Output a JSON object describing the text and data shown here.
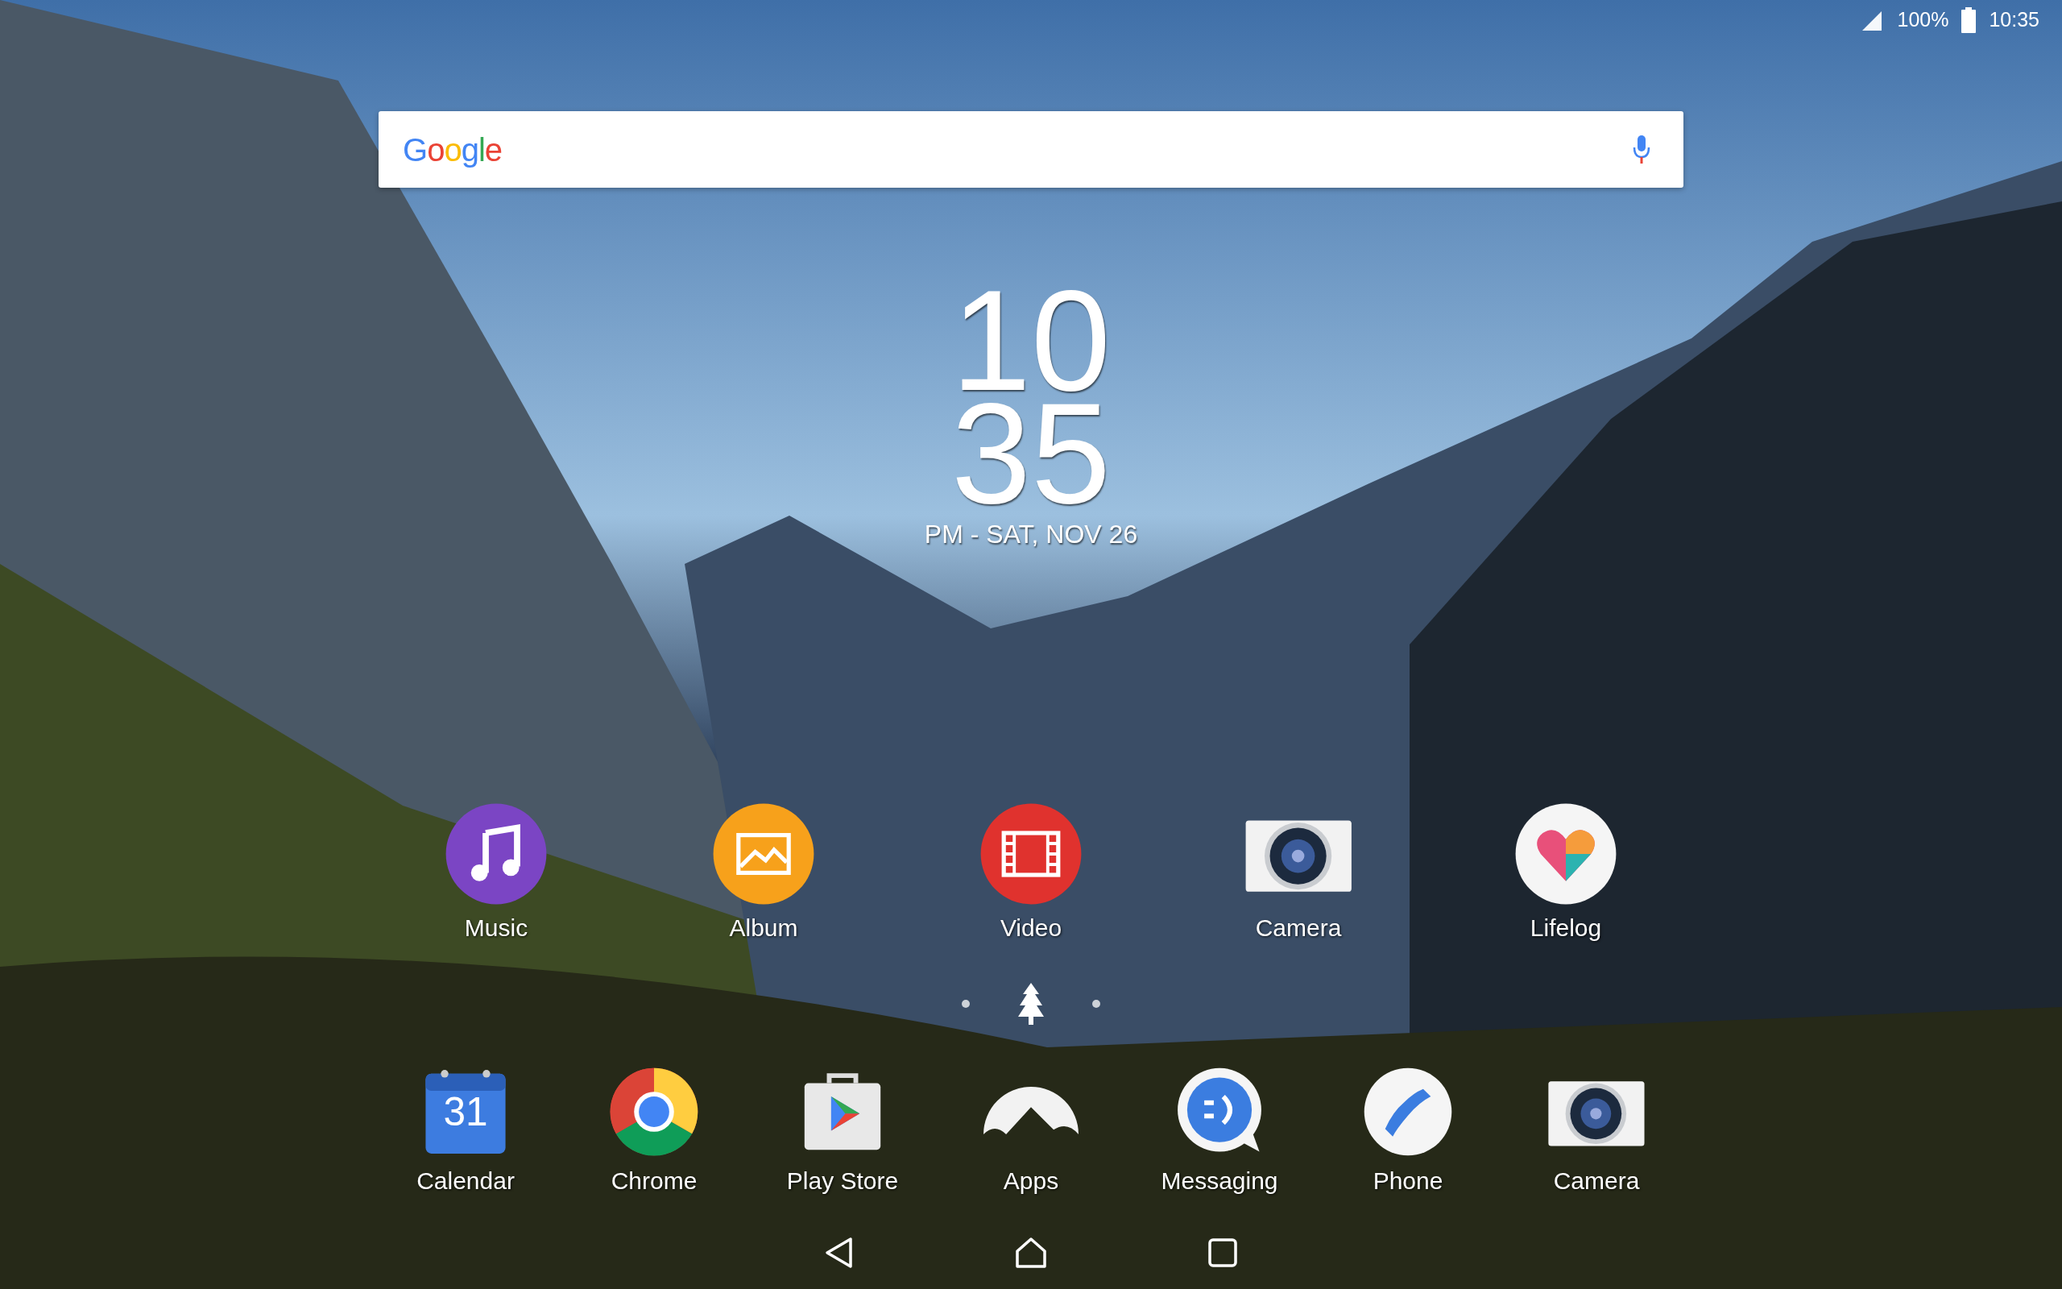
{
  "status_bar": {
    "battery": "100%",
    "time": "10:35"
  },
  "search_bar": {
    "logo": "Google"
  },
  "clock": {
    "hours": "10",
    "minutes": "35",
    "date": "PM - SAT, NOV 26"
  },
  "apps": [
    {
      "kind": "music",
      "label": "Music"
    },
    {
      "kind": "album",
      "label": "Album"
    },
    {
      "kind": "video",
      "label": "Video"
    },
    {
      "kind": "camera",
      "label": "Camera"
    },
    {
      "kind": "lifelog",
      "label": "Lifelog"
    }
  ],
  "page_indicator": [
    {
      "kind": "dot",
      "selected": false
    },
    {
      "kind": "home",
      "selected": true
    },
    {
      "kind": "dot",
      "selected": false
    }
  ],
  "dock": [
    {
      "kind": "calendar",
      "label": "Calendar",
      "icon_text": "31"
    },
    {
      "kind": "chrome",
      "label": "Chrome"
    },
    {
      "kind": "playstore",
      "label": "Play Store"
    },
    {
      "kind": "apps",
      "label": "Apps"
    },
    {
      "kind": "messaging",
      "label": "Messaging"
    },
    {
      "kind": "phone",
      "label": "Phone"
    },
    {
      "kind": "camera",
      "label": "Camera"
    }
  ],
  "nav_bar": [
    {
      "kind": "back"
    },
    {
      "kind": "home"
    },
    {
      "kind": "recents"
    }
  ]
}
